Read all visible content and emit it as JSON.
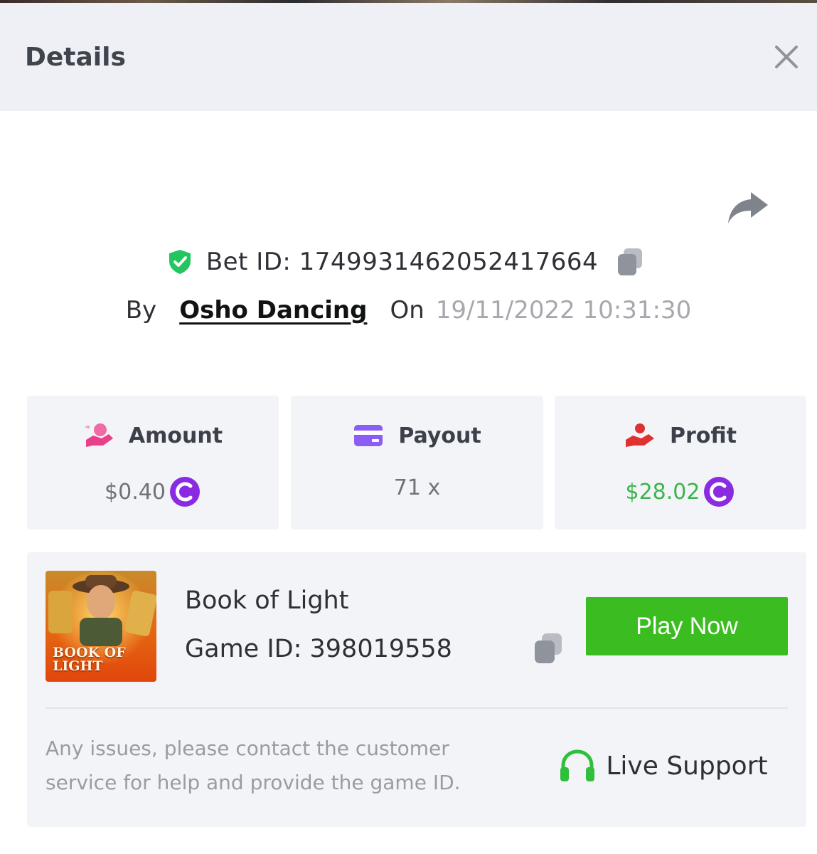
{
  "header": {
    "title": "Details"
  },
  "bet": {
    "id_label": "Bet ID: 1749931462052417664",
    "by_label": "By",
    "user": "Osho Dancing",
    "on_label": "On",
    "datetime": "19/11/2022 10:31:30"
  },
  "stats": {
    "amount": {
      "label": "Amount",
      "value": "$0.40",
      "icon": "hand-coins-icon"
    },
    "payout": {
      "label": "Payout",
      "value": "71 x",
      "icon": "card-icon"
    },
    "profit": {
      "label": "Profit",
      "value": "$28.02",
      "icon": "hand-heart-icon",
      "value_color": "#3bb54a"
    }
  },
  "game": {
    "name": "Book of Light",
    "id_label": "Game ID: 398019558",
    "thumb_title": "BOOK OF LIGHT",
    "play_label": "Play Now"
  },
  "support": {
    "help_text": "Any issues, please contact the customer service for help and provide the game ID.",
    "live_label": "Live Support"
  },
  "colors": {
    "accent_green": "#3bbd22",
    "coin_purple": "#8a2be2",
    "shield_green": "#22c55e"
  }
}
